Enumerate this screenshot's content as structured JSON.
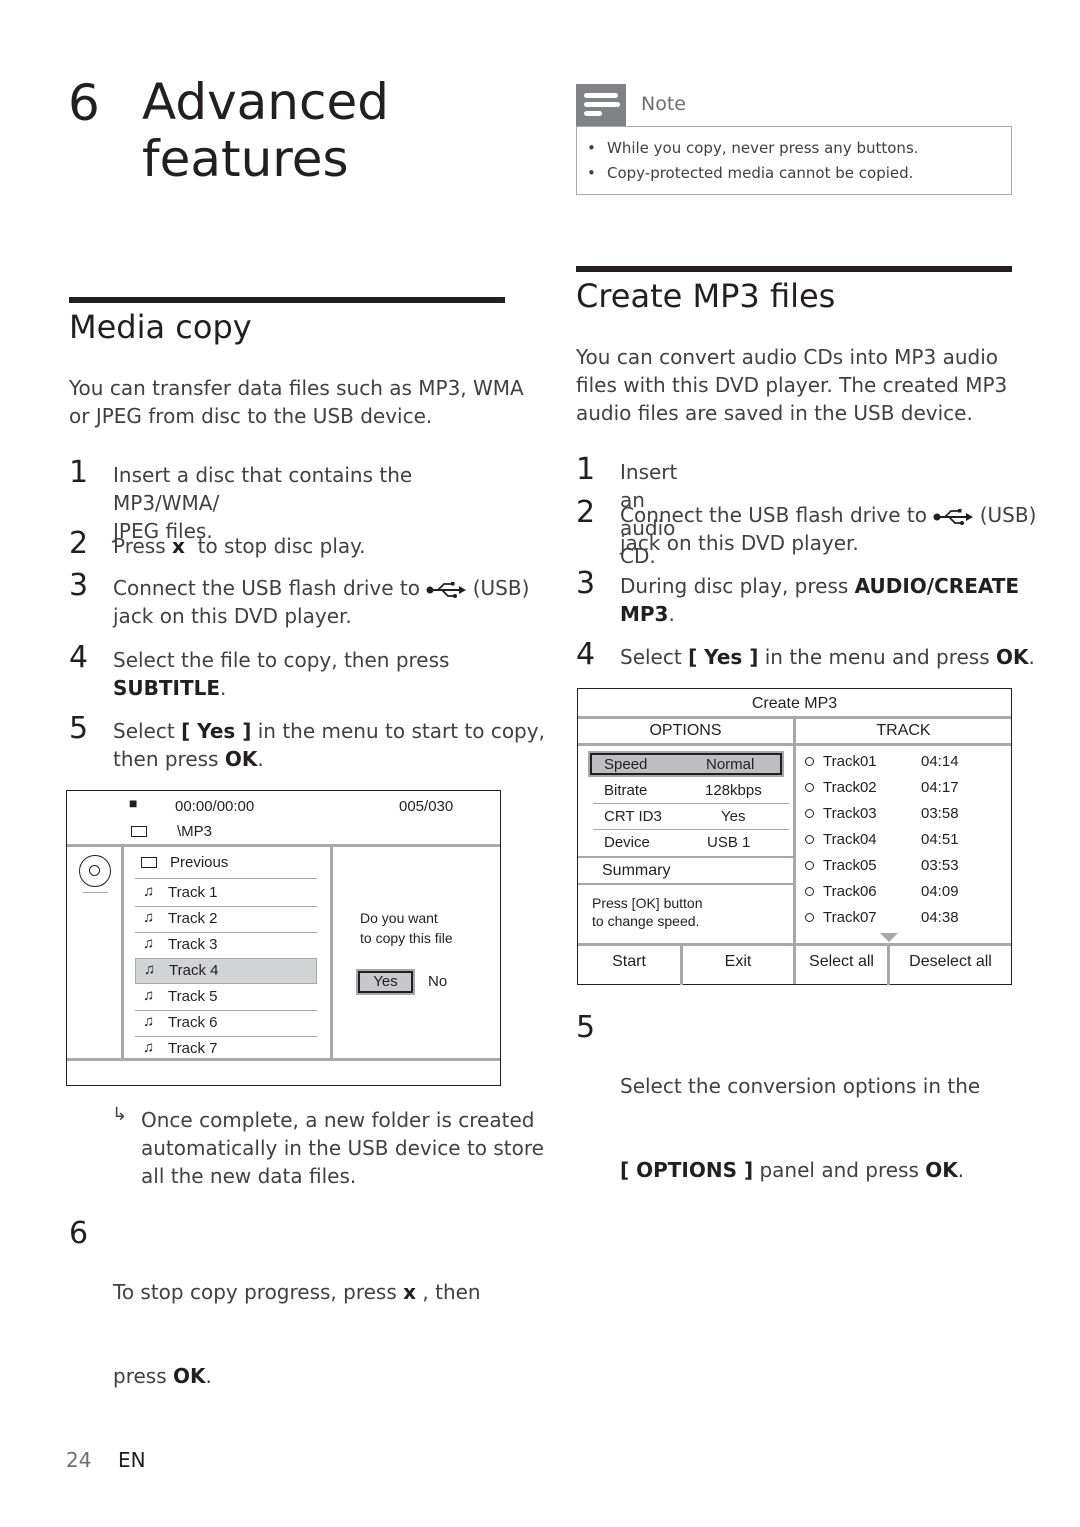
{
  "chapter": {
    "number": "6",
    "title_line1": "Advanced",
    "title_line2": "features"
  },
  "note": {
    "icon": "note-lines-icon",
    "label": "Note",
    "items": [
      "While you copy, never press any buttons.",
      "Copy-protected media cannot be copied."
    ],
    "bullet": "•"
  },
  "media_copy": {
    "title": "Media copy",
    "intro_line1": "You can transfer data files such as MP3, WMA",
    "intro_line2": "or JPEG from disc to the USB device.",
    "steps": [
      {
        "num": "1",
        "line1": "Insert a disc that contains the MP3/WMA/",
        "line2": "JPEG files."
      },
      {
        "num": "2",
        "pre": "Press ",
        "key": "x",
        "post": "  to stop disc play."
      },
      {
        "num": "3",
        "pre": "Connect the USB flash drive to ",
        "post": " (USB)",
        "line2": "jack on this DVD player."
      },
      {
        "num": "4",
        "line1": "Select the file to copy, then press",
        "key": "SUBTITLE",
        "post": "."
      },
      {
        "num": "5",
        "pre": "Select ",
        "key": "[ Yes ]",
        "post": " in the menu to start to copy,",
        "line2_pre": "then press ",
        "line2_key": "OK",
        "line2_post": "."
      },
      {
        "num": "6",
        "pre": "To stop copy progress, press ",
        "key": "x",
        "post": " , then",
        "line2_pre": "press ",
        "line2_key": "OK",
        "line2_post": "."
      }
    ],
    "result_arrow": "↳",
    "result_lines": [
      "Once complete, a new folder is created",
      "automatically in the USB device to store",
      "all the new data files."
    ],
    "screen": {
      "stop_icon": "■",
      "time": "00:00/00:00",
      "counter": "005/030",
      "folder_path": "\\MP3",
      "previous_label": "Previous",
      "tracks": [
        "Track 1",
        "Track 2",
        "Track 3",
        "Track 4",
        "Track 5",
        "Track 6",
        "Track 7"
      ],
      "selected_track": "Track 4",
      "note_glyph": "♫",
      "prompt_line1": "Do you want",
      "prompt_line2": "to copy this file",
      "yes_label": "Yes",
      "no_label": "No"
    }
  },
  "create_mp3": {
    "title": "Create MP3 files",
    "intro_lines": [
      "You can convert audio CDs into MP3 audio",
      "files with this DVD player. The created MP3",
      "audio files are saved in the USB device."
    ],
    "steps": [
      {
        "num": "1",
        "line1": "Insert an audio CD."
      },
      {
        "num": "2",
        "pre": "Connect the USB flash drive to ",
        "post": " (USB)",
        "line2": "jack on this DVD player."
      },
      {
        "num": "3",
        "pre": "During disc play, press ",
        "key": "AUDIO/CREATE",
        "line2_key": "MP3",
        "line2_post": "."
      },
      {
        "num": "4",
        "pre": "Select ",
        "key": "[ Yes ]",
        "post": " in the menu and press ",
        "key2": "OK",
        "post2": "."
      },
      {
        "num": "5",
        "line1": "Select the conversion options in the",
        "line2_key": "[ OPTIONS ]",
        "line2_post": " panel and press ",
        "line2_key2": "OK",
        "line2_post2": "."
      }
    ],
    "screen": {
      "title": "Create MP3",
      "options_header": "OPTIONS",
      "track_header": "TRACK",
      "options": [
        {
          "label": "Speed",
          "value": "Normal"
        },
        {
          "label": "Bitrate",
          "value": "128kbps"
        },
        {
          "label": "CRT ID3",
          "value": "Yes"
        },
        {
          "label": "Device",
          "value": "USB 1"
        }
      ],
      "selected_option": "Speed",
      "summary_label": "Summary",
      "hint_line1": "Press [OK] button",
      "hint_line2": "to change speed.",
      "tracks": [
        {
          "name": "Track01",
          "time": "04:14"
        },
        {
          "name": "Track02",
          "time": "04:17"
        },
        {
          "name": "Track03",
          "time": "03:58"
        },
        {
          "name": "Track04",
          "time": "04:51"
        },
        {
          "name": "Track05",
          "time": "03:53"
        },
        {
          "name": "Track06",
          "time": "04:09"
        },
        {
          "name": "Track07",
          "time": "04:38"
        }
      ],
      "buttons": [
        "Start",
        "Exit",
        "Select all",
        "Deselect all"
      ]
    }
  },
  "footer": {
    "page_number": "24",
    "language": "EN"
  }
}
